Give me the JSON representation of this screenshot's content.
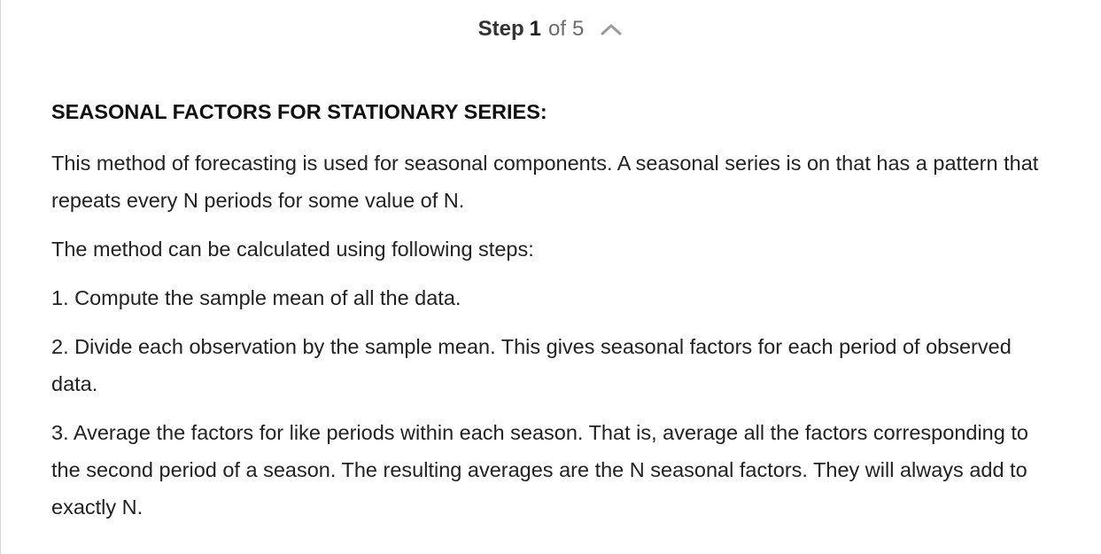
{
  "header": {
    "step_word": "Step",
    "step_current": "1",
    "of_word": "of",
    "step_total": "5",
    "toggle_icon": "chevron-up-icon"
  },
  "content": {
    "title": "SEASONAL FACTORS FOR STATIONARY SERIES:",
    "paragraphs": [
      "This method of forecasting is used for seasonal components. A seasonal series is on that has a pattern that repeats every N periods for some value of N.",
      "The method can be calculated using following steps:",
      "1. Compute the sample mean of all the data.",
      "2. Divide each observation by the sample mean. This gives seasonal factors for each period of observed data.",
      "3. Average the factors for like periods within each season. That is, average all the factors corresponding to the second period of a season. The resulting averages are the N seasonal factors. They will always add to exactly N."
    ]
  }
}
